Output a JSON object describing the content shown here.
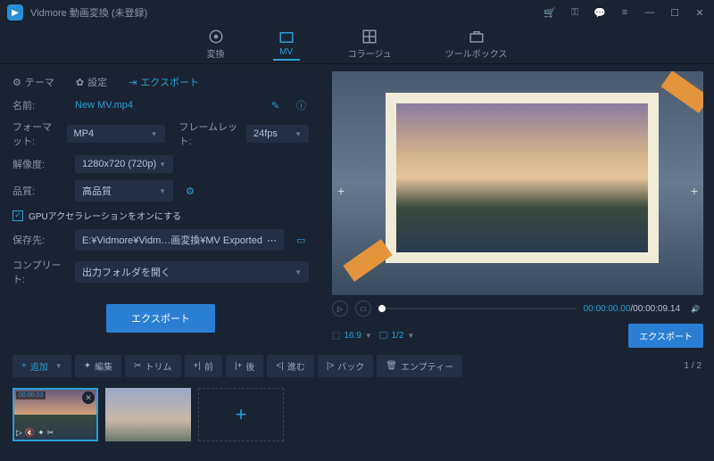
{
  "app": {
    "title": "Vidmore 動画変換 (未登録)"
  },
  "tabs": [
    {
      "label": "変換"
    },
    {
      "label": "MV"
    },
    {
      "label": "コラージュ"
    },
    {
      "label": "ツールボックス"
    }
  ],
  "subtabs": {
    "theme": "テーマ",
    "settings": "設定",
    "export": "エクスポート"
  },
  "form": {
    "name_label": "名前:",
    "name_value": "New MV.mp4",
    "format_label": "フォーマット:",
    "format_value": "MP4",
    "framerate_label": "フレームレット:",
    "framerate_value": "24fps",
    "resolution_label": "解像度:",
    "resolution_value": "1280x720 (720p)",
    "quality_label": "品質:",
    "quality_value": "高品質",
    "gpu_label": "GPUアクセラレーションをオンにする",
    "save_label": "保存先:",
    "save_value": "E:¥Vidmore¥Vidm…画変換¥MV Exported",
    "complete_label": "コンプリート:",
    "complete_value": "出力フォルダを開く",
    "export_button": "エクスポート"
  },
  "preview": {
    "time_current": "00:00:00.00",
    "time_total": "00:00:09.14",
    "aspect": "16:9",
    "display": "1/2",
    "export_button": "エクスポート"
  },
  "toolbar": {
    "add": "追加",
    "edit": "編集",
    "trim": "トリム",
    "before": "前",
    "after": "後",
    "forward": "進む",
    "back": "バック",
    "empty": "エンプティー"
  },
  "thumbs": {
    "t1_duration": "00:00:03",
    "page": "1 / 2"
  }
}
